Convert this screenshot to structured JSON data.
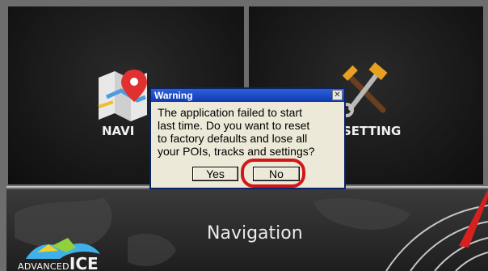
{
  "tiles": {
    "navi": {
      "label": "NAVI",
      "icon": "map-pin-icon"
    },
    "setting": {
      "label": "SETTING",
      "icon": "wrench-hammer-icon"
    }
  },
  "bottom_bar": {
    "title": "Navigation",
    "logo_small": "ADVANCED",
    "logo_large": "ICE"
  },
  "dialog": {
    "title": "Warning",
    "message_lines": [
      "The application failed to start",
      "last time. Do you want to reset",
      "to factory defaults and lose all",
      "your POIs, tracks and settings?"
    ],
    "yes_label": "Yes",
    "no_label": "No",
    "close_glyph": "✕"
  },
  "colors": {
    "titlebar": "#1a49c4",
    "dialog_bg": "#ece9d8",
    "highlight": "#d11818"
  }
}
